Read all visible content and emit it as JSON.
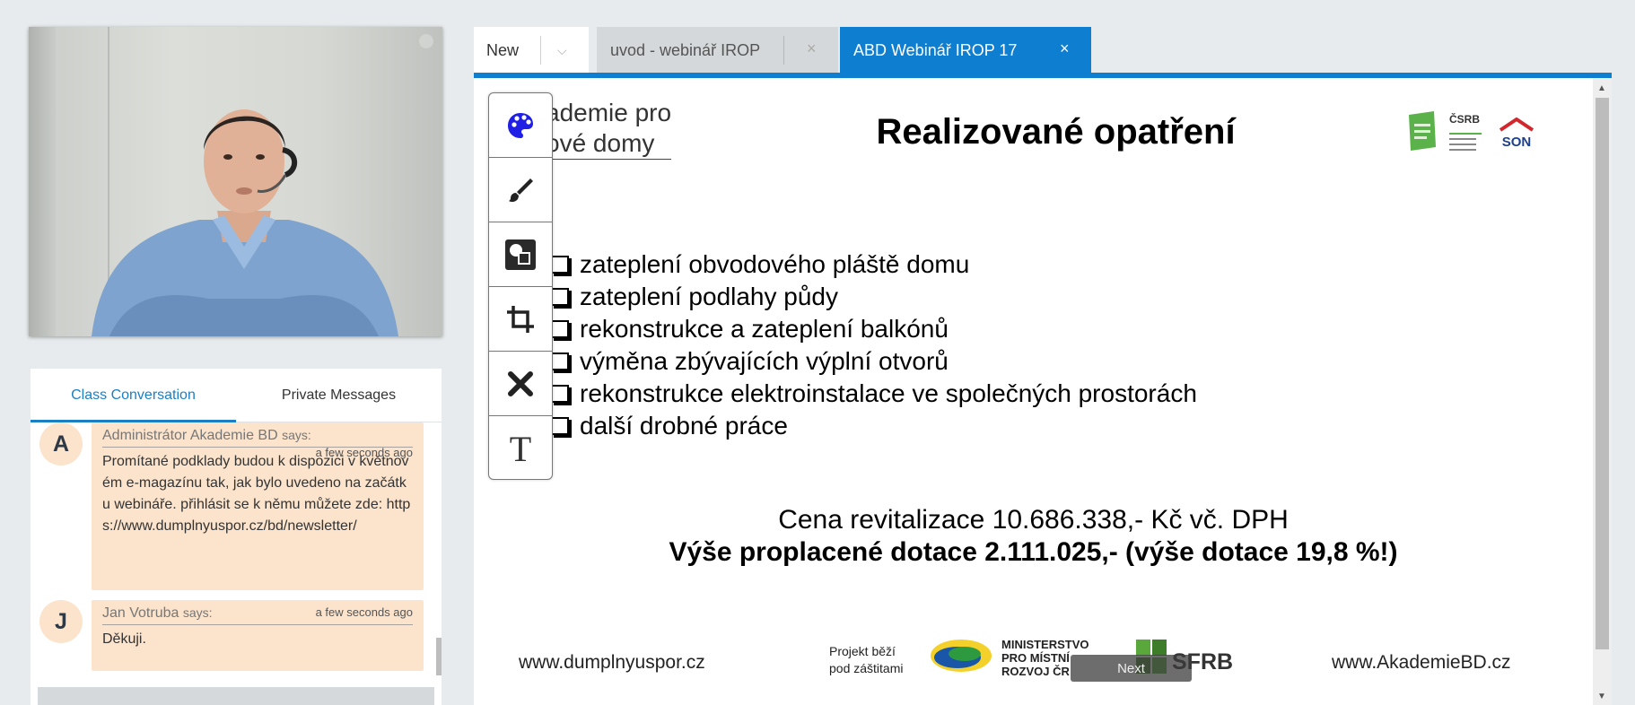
{
  "chat": {
    "tabs": [
      "Class Conversation",
      "Private Messages"
    ],
    "messages": [
      {
        "initial": "A",
        "author": "Administrátor Akademie BD",
        "says": "says:",
        "time": "a few seconds ago",
        "text": "Promítané podklady budou k dispozici v květnovém e-magazínu tak, jak bylo uvedeno na začátku webináře. přihlásit se k němu můžete zde: https://www.dumplnyuspor.cz/bd/newsletter/"
      },
      {
        "initial": "J",
        "author": "Jan Votruba",
        "says": "says:",
        "time": "a few seconds ago",
        "text": "Děkuji."
      }
    ]
  },
  "tabs": {
    "new_label": "New",
    "doc1": "uvod - webinář IROP",
    "doc2": "ABD Webinář IROP 17",
    "close_glyph": "×",
    "chevron": "⌵"
  },
  "slide": {
    "logo_line1": "ademie pro",
    "logo_line2": "ové domy",
    "title": "Realizované opatření",
    "bullets": [
      "zateplení obvodového pláště domu",
      "zateplení podlahy půdy",
      "rekonstrukce a zateplení balkónů",
      "výměna zbývajících výplní otvorů",
      "rekonstrukce elektroinstalace ve společných prostorách",
      "další drobné práce"
    ],
    "price": "Cena revitalizace 10.686.338,- Kč vč. DPH",
    "subsidy": "Výše proplacené dotace 2.111.025,- (výše dotace 19,8 %!)",
    "footer_left": "www.dumplnyuspor.cz",
    "footer_right": "www.AkademieBD.cz",
    "patron_line1": "Projekt běží",
    "patron_line2": "pod záštitami",
    "mmr_line1": "MINISTERSTVO",
    "mmr_line2": "PRO MÍSTNÍ",
    "mmr_line3": "ROZVOJ ČR",
    "sfrb": "SFRB",
    "partner_csrb": "ČSRB",
    "partner_son": "SON",
    "next_label": "Next"
  },
  "toolbar": {
    "tools": [
      "palette-icon",
      "brush-icon",
      "shapes-icon",
      "crop-icon",
      "close-icon",
      "text-icon"
    ],
    "text_glyph": "T"
  },
  "colors": {
    "accent": "#0e7ed1",
    "chat_bubble": "#fbe3cc",
    "palette_blue": "#1f1fe6"
  }
}
